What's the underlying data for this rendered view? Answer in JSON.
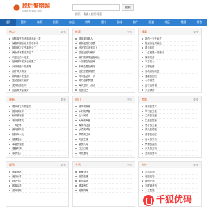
{
  "site": {
    "name": "脱后瞥崩网",
    "url": "www.t-hbzl.com"
  },
  "search": {
    "placeholder": "搜索：请输入搜索词语",
    "button": "搜索"
  },
  "nav": {
    "items": [
      "首页",
      "国外",
      "商家",
      "搜索",
      "商品",
      "新闻",
      "图片",
      "游戏",
      "软件",
      "频道",
      "地区",
      "视频",
      "问答"
    ],
    "active_index": 0
  },
  "cards": [
    {
      "title": "热点",
      "more": "更多",
      "items": [
        "请加端午节资料请参考上表",
        "暑假特别版信息表可参考",
        "那天我决定先离开去了",
        "美女请不要说再见了",
        "与自己交个朋友",
        "回来的时候天已经黑了",
        "对未来做个规划吧",
        "我们明天再见",
        "那年那月发生的",
        "生活会越来越好",
        "坚持就是胜利",
        "加油明天会更好"
      ]
    },
    {
      "title": "推荐",
      "more": "更多",
      "items": [
        "那年那月那人",
        "最新信息汇总表",
        "好好学习天天向上",
        "总结经验与教训",
        "我们的故事还在继续",
        "一切都会好起来",
        "未来会更加美好",
        "回忆总是美丽的",
        "时间会证明一切",
        "努力追求梦想",
        "每天进步一点点",
        "相信自己"
      ]
    },
    {
      "title": "精彩",
      "more": "更多",
      "items": [
        "新的一天开始了",
        "阳光总在风雨后",
        "看见彩虹",
        "人生就是一场旅行",
        "静待花开",
        "不忘初心",
        "方得始终",
        "向着目标前进",
        "温暖的回忆",
        "心怀感恩",
        "且行且珍惜",
        "岁月静好"
      ]
    },
    {
      "title": "最新",
      "more": "更多",
      "items": [
        "春天来了万物复苏",
        "夏天的故事",
        "秋天的收获",
        "冬天的雪花",
        "一年四季",
        "美好的时光",
        "快乐每一天",
        "健康生活",
        "幸福的家庭",
        "温馨时刻",
        "亲情无价",
        "友谊长存"
      ]
    },
    {
      "title": "热门",
      "more": "更多",
      "items": [
        "城市的夜晚",
        "乡村的早晨",
        "山川河流",
        "大海的声音",
        "森林的秘密",
        "沙漠的风景",
        "草原的辽阔",
        "天空之城",
        "星辰大海",
        "日出日落",
        "风花雪月",
        "诗和远方"
      ]
    },
    {
      "title": "专题",
      "more": "更多",
      "items": [
        "读书的意义",
        "学习的方法",
        "工作的态度",
        "生活的智慧",
        "思考的力量",
        "成长的烦恼",
        "青春的记忆",
        "奋斗的岁月",
        "梦想的起点",
        "未来的方向",
        "坚持的意义",
        "成功的秘诀"
      ]
    },
    {
      "title": "娱乐",
      "more": "更多",
      "items": [
        "电影推荐",
        "音乐分享",
        "综艺节目",
        "明星动态",
        "游戏攻略"
      ]
    },
    {
      "title": "生活",
      "more": "更多",
      "items": [
        "美食制作",
        "旅游攻略",
        "家居装修",
        "健康养生",
        "宠物饲养"
      ]
    },
    {
      "title": "科技",
      "more": "更多",
      "items": [
        "手机评测",
        "电脑技巧",
        "数码产品",
        "互联网资讯",
        "人工智能"
      ]
    }
  ],
  "watermark": {
    "text": "千狐优码"
  }
}
